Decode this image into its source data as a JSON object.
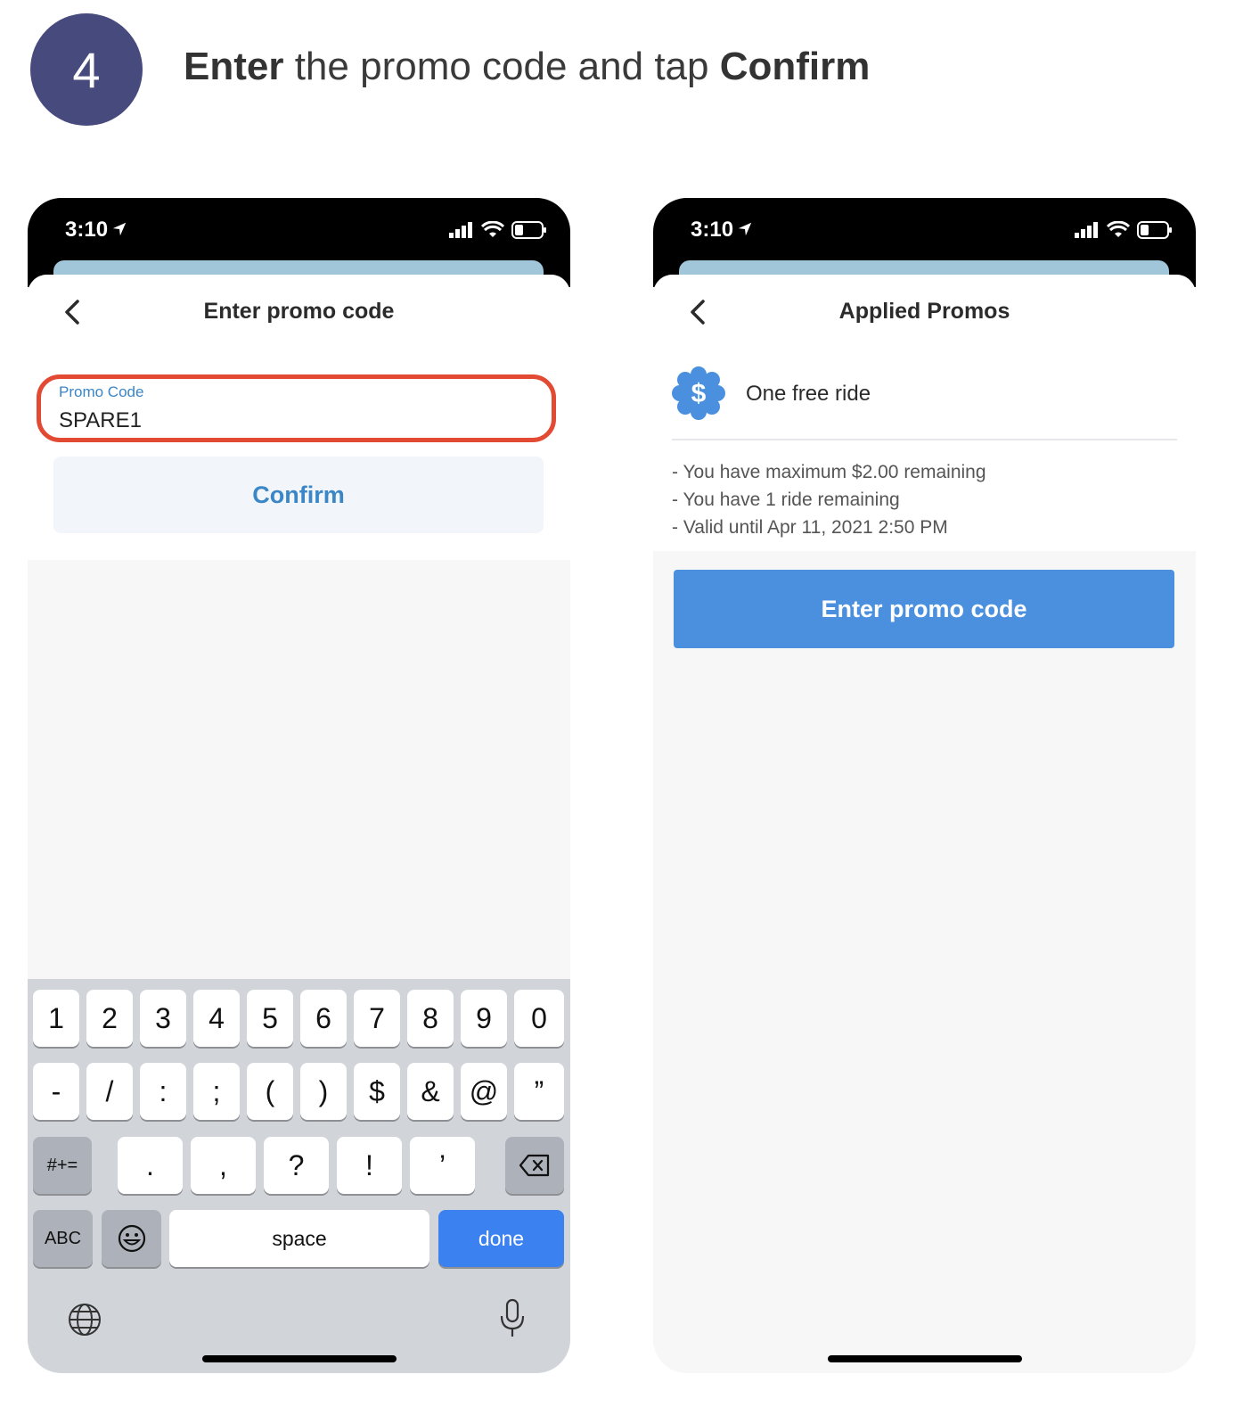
{
  "step": {
    "number": "4",
    "title_bold_1": "Enter",
    "title_middle": " the promo code and tap ",
    "title_bold_2": "Confirm"
  },
  "left_phone": {
    "time": "3:10",
    "sheet_title": "Enter promo code",
    "promo_field": {
      "label": "Promo Code",
      "value": "SPARE1"
    },
    "confirm_label": "Confirm",
    "keyboard": {
      "row1": [
        "1",
        "2",
        "3",
        "4",
        "5",
        "6",
        "7",
        "8",
        "9",
        "0"
      ],
      "row2": [
        "-",
        "/",
        ":",
        ";",
        "(",
        ")",
        "$",
        "&",
        "@",
        "”"
      ],
      "row3": [
        ".",
        ",",
        "?",
        "!",
        "’"
      ],
      "symbols_key": "#+=",
      "abc_key": "ABC",
      "space_key": "space",
      "done_key": "done"
    }
  },
  "right_phone": {
    "time": "3:10",
    "sheet_title": "Applied Promos",
    "promo_name": "One free ride",
    "details": [
      "- You have maximum $2.00 remaining",
      "- You have 1 ride remaining",
      "- Valid until Apr 11, 2021 2:50 PM"
    ],
    "enter_button": "Enter promo code"
  },
  "colors": {
    "step_circle": "#474a7c",
    "highlight_ring": "#e24a33",
    "accent_blue": "#3a86c6",
    "button_blue": "#4a90df",
    "done_key": "#3b82f0"
  }
}
